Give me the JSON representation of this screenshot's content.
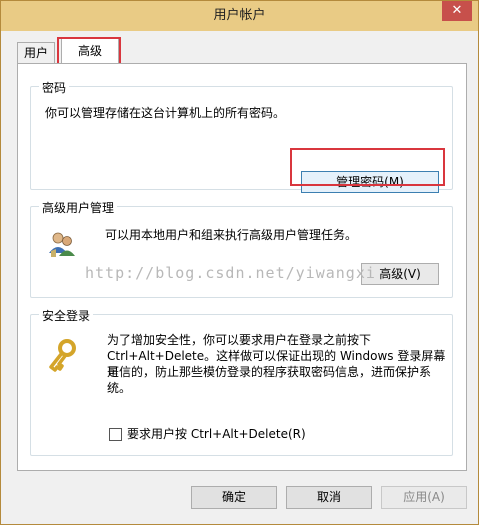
{
  "window": {
    "title": "用户帐户",
    "close_glyph": "✕"
  },
  "tabs": [
    {
      "label": "用户"
    },
    {
      "label": "高级"
    }
  ],
  "password_group": {
    "title": "密码",
    "description": "你可以管理存储在这台计算机上的所有密码。",
    "button_label": "管理密码(M)"
  },
  "advanced_user_group": {
    "title": "高级用户管理",
    "description": "可以用本地用户和组来执行高级用户管理任务。",
    "button_label": "高级(V)",
    "icon": "users-icon"
  },
  "secure_logon_group": {
    "title": "安全登录",
    "description_lines": [
      "为了增加安全性，你可以要求用户在登录之前按下",
      "Ctrl+Alt+Delete。这样做可以保证出现的 Windows 登录屏幕是",
      "可信的，防止那些模仿登录的程序获取密码信息，进而保护系",
      "统。"
    ],
    "checkbox_label": "要求用户按 Ctrl+Alt+Delete(R)",
    "icon": "key-icon"
  },
  "watermark": "http://blog.csdn.net/yiwangxi",
  "footer": {
    "ok_label": "确定",
    "cancel_label": "取消",
    "apply_label": "应用(A)"
  },
  "colors": {
    "highlight": "#d9363e",
    "titlebar": "#e9cb85",
    "close": "#c7504b"
  }
}
